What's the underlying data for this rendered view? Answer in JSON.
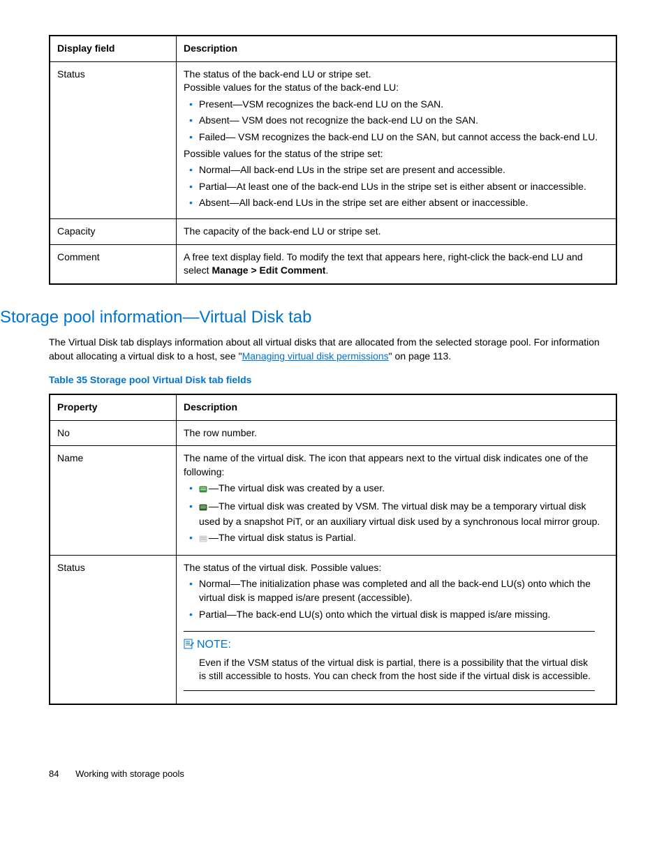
{
  "table1": {
    "headers": [
      "Display field",
      "Description"
    ],
    "rows": {
      "status": {
        "label": "Status",
        "intro1": "The status of the back-end LU or stripe set.",
        "intro2": "Possible values for the status of the back-end LU:",
        "lu_bullets": [
          "Present—VSM recognizes the back-end LU on the SAN.",
          "Absent— VSM does not recognize the back-end LU on the SAN.",
          "Failed— VSM recognizes the back-end LU on the SAN, but cannot access the back-end LU."
        ],
        "intro3": "Possible values for the status of the stripe set:",
        "stripe_bullets": [
          "Normal—All back-end LUs in the stripe set are present and accessible.",
          "Partial—At least one of the back-end LUs in the stripe set is either absent or inaccessible.",
          "Absent—All back-end LUs in the stripe set are either absent or inaccessible."
        ]
      },
      "capacity": {
        "label": "Capacity",
        "desc": "The capacity of the back-end LU or stripe set."
      },
      "comment": {
        "label": "Comment",
        "desc_pre": "A free text display field. To modify the text that appears here, right-click the back-end LU and select ",
        "desc_bold": "Manage > Edit Comment",
        "desc_post": "."
      }
    }
  },
  "heading": "Storage pool information—Virtual Disk tab",
  "para": {
    "pre": "The Virtual Disk tab displays information about all virtual disks that are allocated from the selected storage pool. For information about allocating a virtual disk to a host, see \"",
    "link": "Managing virtual disk permissions",
    "post": "\" on page 113."
  },
  "caption": "Table 35 Storage pool Virtual Disk tab fields",
  "table2": {
    "headers": [
      "Property",
      "Description"
    ],
    "rows": {
      "no": {
        "label": "No",
        "desc": "The row number."
      },
      "name": {
        "label": "Name",
        "intro": "The name of the virtual disk. The icon that appears next to the virtual disk indicates one of the following:",
        "bullets": [
          "—The virtual disk was created by a user.",
          "—The virtual disk was created by VSM. The virtual disk may be a temporary virtual disk used by a snapshot PiT, or an auxiliary virtual disk used by a synchronous local mirror group.",
          "—The virtual disk status is Partial."
        ]
      },
      "status": {
        "label": "Status",
        "intro": "The status of the virtual disk. Possible values:",
        "bullets": [
          "Normal—The initialization phase was completed and all the back-end LU(s) onto which the virtual disk is mapped is/are present (accessible).",
          "Partial—The back-end LU(s) onto which the virtual disk is mapped is/are missing."
        ],
        "note_label": "NOTE:",
        "note_body": "Even if the VSM status of the virtual disk is partial, there is a possibility that the virtual disk is still accessible to hosts. You can check from the host side if the virtual disk is accessible."
      }
    }
  },
  "footer": {
    "page": "84",
    "chapter": "Working with storage pools"
  }
}
